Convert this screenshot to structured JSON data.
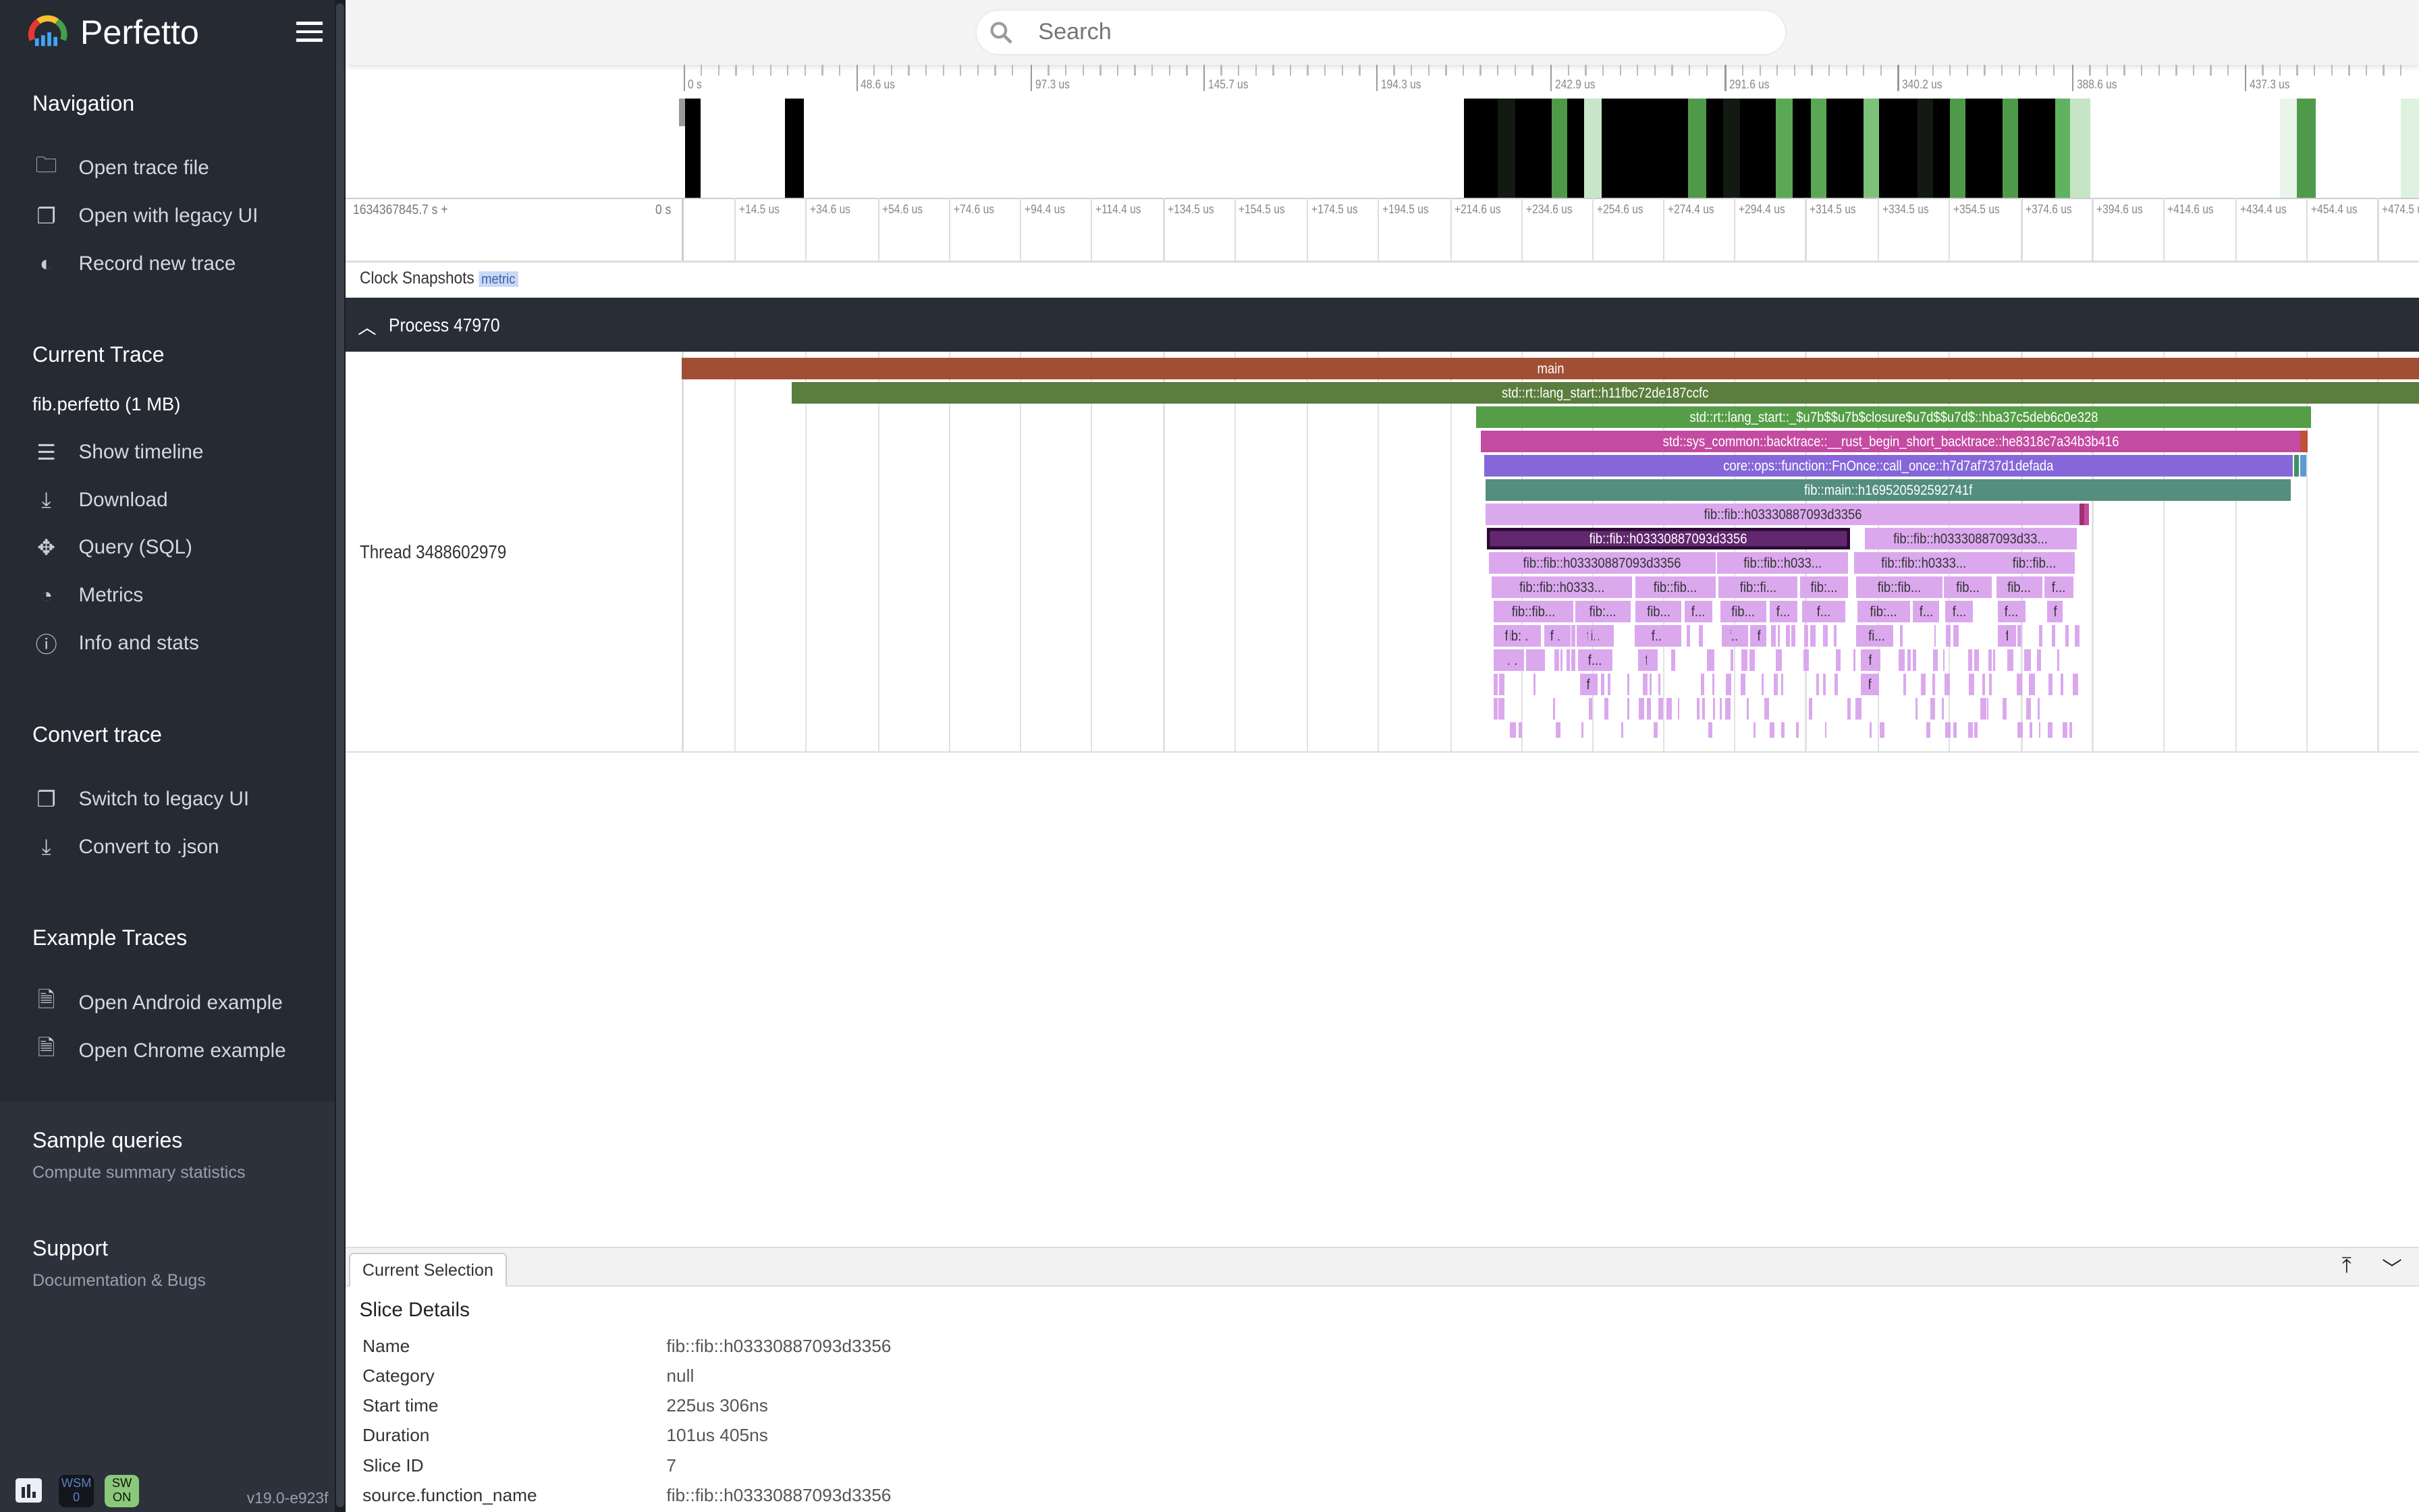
{
  "app": {
    "title": "Perfetto",
    "version": "v19.0-e923f"
  },
  "search": {
    "placeholder": "Search"
  },
  "sidebar": {
    "sections": [
      {
        "title": "Navigation",
        "items": [
          {
            "label": "Open trace file",
            "icon": "folder-icon"
          },
          {
            "label": "Open with legacy UI",
            "icon": "filter-none-icon"
          },
          {
            "label": "Record new trace",
            "icon": "toggle-icon"
          }
        ]
      },
      {
        "title": "Current Trace",
        "subtitle": "fib.perfetto (1 MB)",
        "items": [
          {
            "label": "Show timeline",
            "icon": "timeline-icon"
          },
          {
            "label": "Download",
            "icon": "download-icon"
          },
          {
            "label": "Query (SQL)",
            "icon": "query-icon"
          },
          {
            "label": "Metrics",
            "icon": "speedometer-icon"
          },
          {
            "label": "Info and stats",
            "icon": "info-icon"
          }
        ]
      },
      {
        "title": "Convert trace",
        "items": [
          {
            "label": "Switch to legacy UI",
            "icon": "filter-none-icon"
          },
          {
            "label": "Convert to .json",
            "icon": "download-icon"
          }
        ]
      },
      {
        "title": "Example Traces",
        "items": [
          {
            "label": "Open Android example",
            "icon": "file-icon"
          },
          {
            "label": "Open Chrome example",
            "icon": "file-icon"
          }
        ]
      }
    ],
    "sample_queries": {
      "title": "Sample queries",
      "subtitle": "Compute summary statistics"
    },
    "support": {
      "title": "Support",
      "subtitle": "Documentation & Bugs"
    },
    "footer": {
      "wsm": "WSM",
      "wsm_count": "0",
      "sw": "SW",
      "sw_state": "ON"
    }
  },
  "overview": {
    "ticks": [
      "0 s",
      "48.6 us",
      "97.3 us",
      "145.7 us",
      "194.3 us",
      "242.9 us",
      "291.6 us",
      "340.2 us",
      "388.6 us",
      "437.3 us"
    ]
  },
  "ruler": {
    "offset": "1634367845.7 s +",
    "zero": "0 s",
    "ticks": [
      "+14.5 us",
      "+34.6 us",
      "+54.6 us",
      "+74.6 us",
      "+94.4 us",
      "+114.4 us",
      "+134.5 us",
      "+154.5 us",
      "+174.5 us",
      "+194.5 us",
      "+214.6 us",
      "+234.6 us",
      "+254.6 us",
      "+274.4 us",
      "+294.4 us",
      "+314.5 us",
      "+334.5 us",
      "+354.5 us",
      "+374.6 us",
      "+394.6 us",
      "+414.6 us",
      "+434.4 us",
      "+454.4 us",
      "+474.5 us"
    ]
  },
  "tracks": {
    "clock": "Clock Snapshots",
    "clock_badge": "metric",
    "process": "Process 47970",
    "thread": "Thread 3488602979"
  },
  "colors": {
    "main": "#a04f34",
    "lang_start": "#5a7e3d",
    "closure": "#559e47",
    "backtrace": "#c44ba2",
    "call_once": "#8667da",
    "fib_main": "#548e7d",
    "fib": "#dba8ee",
    "selected": "#62286f"
  },
  "slices": [
    {
      "name": "main"
    },
    {
      "name": "std::rt::lang_start::h11fbc72de187ccfc"
    },
    {
      "name": "std::rt::lang_start::_$u7b$$u7b$closure$u7d$$u7d$::hba37c5deb6c0e328"
    },
    {
      "name": "std::sys_common::backtrace::__rust_begin_short_backtrace::he8318c7a34b3b416"
    },
    {
      "name": "core::ops::function::FnOnce::call_once::h7d7af737d1defada"
    },
    {
      "name": "fib::main::h169520592592741f"
    },
    {
      "name": "fib::fib::h03330887093d3356"
    },
    {
      "name": "fib::fib::h03330887093d3356"
    },
    {
      "name": "fib::fib::h03330887093d33..."
    },
    {
      "name": "fib::fib::h03330887093d3356"
    },
    {
      "name": "fib::fib::h033..."
    },
    {
      "name": "fib::fib::h0333..."
    },
    {
      "name": "fib::fib..."
    },
    {
      "name": "fib::fib::h0333..."
    },
    {
      "name": "fib::fib..."
    },
    {
      "name": "fib::fi..."
    },
    {
      "name": "fib:..."
    },
    {
      "name": "fib::fib..."
    },
    {
      "name": "fib..."
    },
    {
      "name": "fib..."
    },
    {
      "name": "f..."
    },
    {
      "name": "fib::fib..."
    },
    {
      "name": "fib:..."
    },
    {
      "name": "fib..."
    },
    {
      "name": "f..."
    },
    {
      "name": "fib..."
    },
    {
      "name": "f..."
    },
    {
      "name": "f..."
    },
    {
      "name": "fib:..."
    },
    {
      "name": "f..."
    },
    {
      "name": "f..."
    },
    {
      "name": "f..."
    },
    {
      "name": "f"
    },
    {
      "name": "fib:..."
    },
    {
      "name": "f..."
    },
    {
      "name": "fi..."
    },
    {
      "name": "f..."
    },
    {
      "name": "f..."
    },
    {
      "name": "f"
    },
    {
      "name": "fi..."
    },
    {
      "name": "f"
    },
    {
      "name": "f..."
    },
    {
      "name": "f"
    },
    {
      "name": "f..."
    },
    {
      "name": "f"
    },
    {
      "name": "f"
    },
    {
      "name": "f"
    },
    {
      "name": "f"
    }
  ],
  "details": {
    "tab": "Current Selection",
    "title": "Slice Details",
    "rows": [
      {
        "k": "Name",
        "v": "fib::fib::h03330887093d3356"
      },
      {
        "k": "Category",
        "v": "null"
      },
      {
        "k": "Start time",
        "v": "225us 306ns"
      },
      {
        "k": "Duration",
        "v": "101us 405ns"
      },
      {
        "k": "Slice ID",
        "v": "7"
      },
      {
        "k": "source.function_name",
        "v": "fib::fib::h03330887093d3356"
      }
    ]
  }
}
